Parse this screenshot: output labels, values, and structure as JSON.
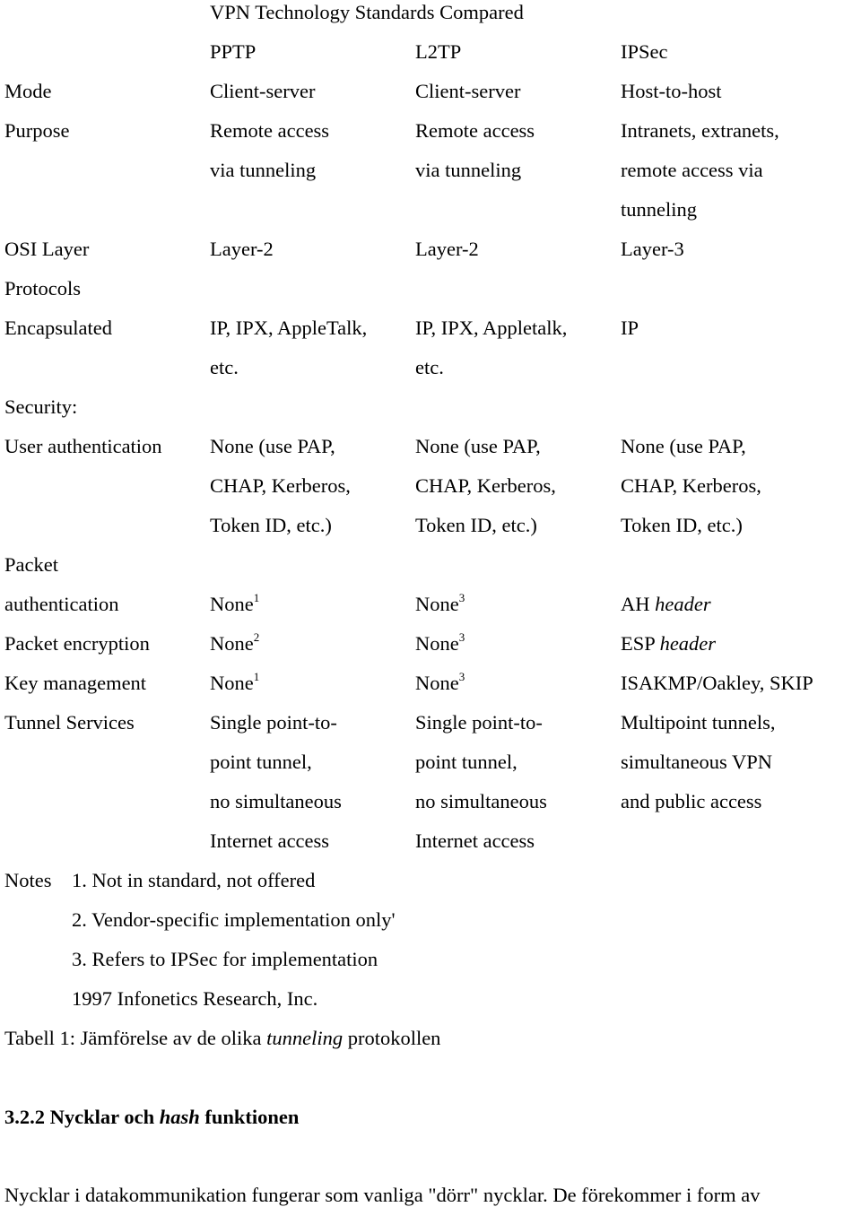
{
  "table": {
    "title": "VPN Technology Standards Compared",
    "columns": [
      "PPTP",
      "L2TP",
      "IPSec"
    ],
    "rows": {
      "mode": {
        "label": "Mode",
        "values": [
          "Client-server",
          "Client-server",
          "Host-to-host"
        ]
      },
      "purpose": {
        "label": "Purpose",
        "values": [
          [
            "Remote access",
            "via tunneling"
          ],
          [
            "Remote access",
            "via tunneling"
          ],
          [
            "Intranets, extranets,",
            "remote access via",
            "tunneling"
          ]
        ]
      },
      "osi_layer": {
        "label": "OSI Layer",
        "values": [
          "Layer-2",
          "Layer-2",
          "Layer-3"
        ]
      },
      "protocols_encapsulated": {
        "label_lines": [
          "Protocols",
          "Encapsulated"
        ],
        "values": [
          [
            "IP, IPX, AppleTalk,",
            "etc."
          ],
          [
            "IP, IPX, Appletalk,",
            "etc."
          ],
          [
            "IP"
          ]
        ]
      },
      "security": {
        "label": "Security:"
      },
      "user_authentication": {
        "label": "User authentication",
        "values": [
          [
            "None (use PAP,",
            "CHAP, Kerberos,",
            "Token ID, etc.)"
          ],
          [
            "None (use PAP,",
            "CHAP, Kerberos,",
            "Token ID, etc.)"
          ],
          [
            "None (use PAP,",
            "CHAP, Kerberos,",
            "Token ID, etc.)"
          ]
        ]
      },
      "packet_authentication": {
        "label_lines": [
          "Packet",
          "authentication"
        ],
        "values": [
          {
            "text": "None",
            "note": "1"
          },
          {
            "text": "None",
            "note": "3"
          },
          {
            "text": "AH",
            "italic": "header"
          }
        ]
      },
      "packet_encryption": {
        "label": "Packet encryption",
        "values": [
          {
            "text": "None",
            "note": "2"
          },
          {
            "text": "None",
            "note": "3"
          },
          {
            "text": "ESP",
            "italic": "header"
          }
        ]
      },
      "key_management": {
        "label": "Key management",
        "values": [
          {
            "text": "None",
            "note": "1"
          },
          {
            "text": "None",
            "note": "3"
          },
          {
            "text": "ISAKMP/Oakley, SKIP"
          }
        ]
      },
      "tunnel_services": {
        "label": "Tunnel Services",
        "values": [
          [
            "Single point-to-",
            "point tunnel,",
            "no simultaneous",
            "Internet access"
          ],
          [
            "Single point-to-",
            "point tunnel,",
            "no simultaneous",
            "Internet access"
          ],
          [
            "Multipoint tunnels,",
            "simultaneous VPN",
            "and public access"
          ]
        ]
      }
    },
    "notes": {
      "label": "Notes",
      "items": [
        "1. Not in standard, not offered",
        "2. Vendor-specific implementation only'",
        "3. Refers to IPSec for implementation",
        "1997 Infonetics Research, Inc."
      ]
    }
  },
  "caption": {
    "prefix": "Tabell 1: Jämförelse av de olika ",
    "italic": "tunneling",
    "suffix": " protokollen"
  },
  "section": {
    "number_and_start": "3.2.2 Nycklar och ",
    "italic": "hash",
    "end": " funktionen"
  },
  "body_text": "Nycklar i datakommunikation fungerar som vanliga \"dörr\" nycklar. De förekommer i form av"
}
